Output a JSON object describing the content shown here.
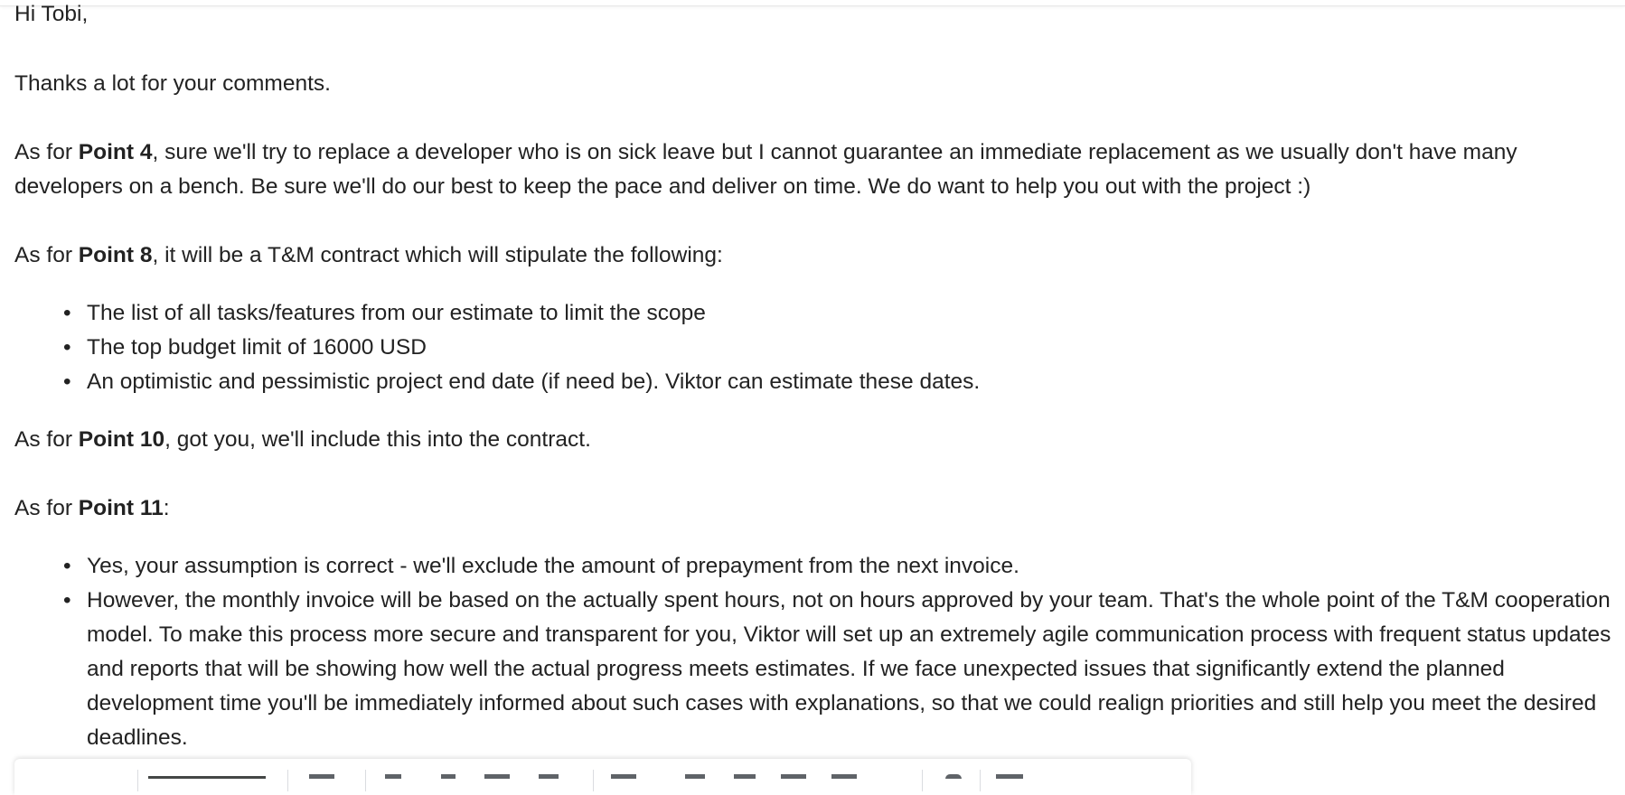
{
  "email": {
    "greeting": "Hi Tobi,",
    "thanks": "Thanks a lot for your comments.",
    "point4": {
      "prefix": "As for ",
      "label": "Point 4",
      "text": ", sure we'll try to replace a developer who is on sick leave but I cannot guarantee an immediate replacement as we usually don't have many developers on a bench. Be sure we'll do our best to keep the pace and deliver on time. We do want to help you out with the project :)"
    },
    "point8": {
      "prefix": "As for ",
      "label": "Point 8",
      "text": ", it will be a T&M contract which will stipulate the following:",
      "items": [
        "The list of all tasks/features from our estimate to limit the scope",
        "The top budget limit of 16000 USD",
        "An optimistic and pessimistic project end date (if need be). Viktor can estimate these dates."
      ]
    },
    "point10": {
      "prefix": "As for ",
      "label": "Point 10",
      "text": ", got you, we'll include this into the contract."
    },
    "point11": {
      "prefix": "As for ",
      "label": "Point 11",
      "text": ":",
      "items": [
        "Yes, your assumption is correct - we'll exclude the amount of prepayment from the next invoice.",
        "However, the monthly invoice will be based on the actually spent hours, not on hours approved by your team. That's the whole point of the T&M cooperation model. To make this process more secure and transparent for you, Viktor will set up an extremely agile communication process with frequent status updates and reports that will be showing how well the actual progress meets estimates. If we face unexpected issues that significantly extend the planned development time you'll be immediately informed about such cases with explanations, so that we could realign priorities and still help you meet the desired deadlines."
      ]
    },
    "bullet": "•"
  },
  "toolbar": {
    "icons": [
      "undo-icon",
      "redo-icon",
      "font-family-dropdown",
      "font-size-icon",
      "bold-icon",
      "italic-icon",
      "underline-icon",
      "text-color-icon",
      "align-icon",
      "numbered-list-icon",
      "bulleted-list-icon",
      "indent-less-icon",
      "indent-more-icon",
      "remove-formatting-icon",
      "more-icon"
    ],
    "font_label": "Sans Serif"
  }
}
